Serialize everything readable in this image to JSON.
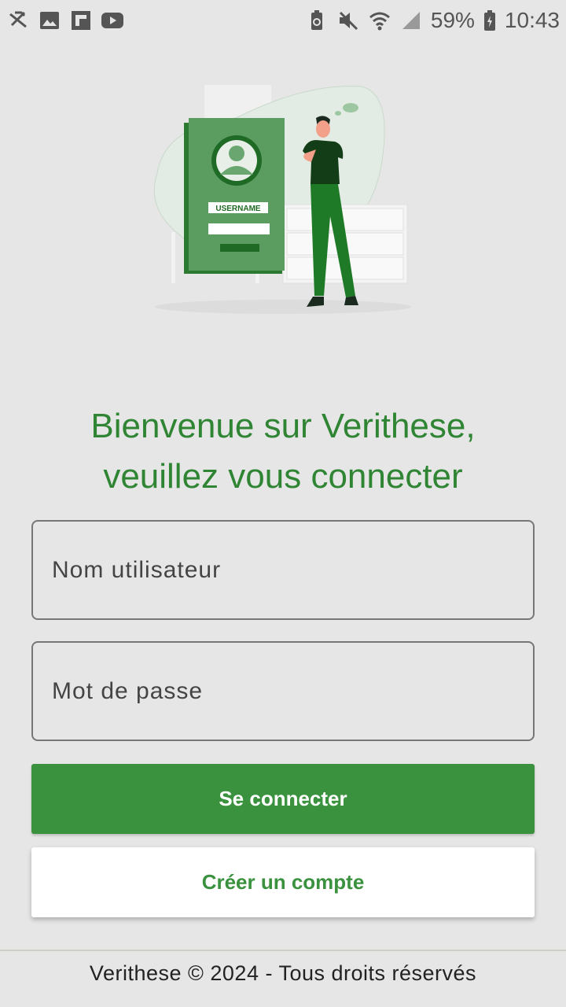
{
  "status_bar": {
    "left_icons": [
      "signal-off-icon",
      "image-icon",
      "flipboard-icon",
      "youtube-icon"
    ],
    "right_icons": [
      "recycle-battery-icon",
      "mute-icon",
      "wifi-icon",
      "cell-signal-icon"
    ],
    "battery": "59%",
    "time": "10:43"
  },
  "illustration": {
    "card_label": "USERNAME"
  },
  "welcome": {
    "line1": "Bienvenue sur Verithese,",
    "line2": "veuillez vous connecter"
  },
  "form": {
    "username_placeholder": "Nom utilisateur",
    "password_placeholder": "Mot de passe",
    "login_label": "Se connecter",
    "create_label": "Créer un compte"
  },
  "footer": {
    "text": "Verithese © 2024 - Tous droits réservés"
  },
  "colors": {
    "primary": "#3a913e",
    "title": "#2f8533",
    "background": "#e6e6e6"
  }
}
